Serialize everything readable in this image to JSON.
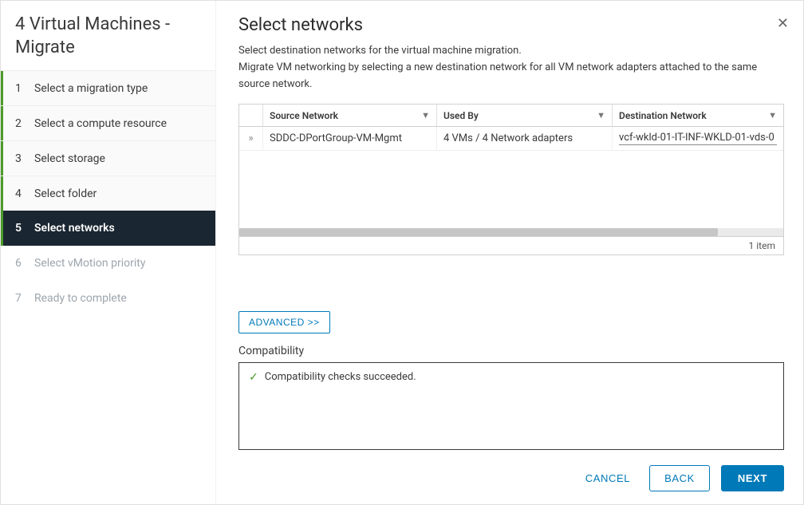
{
  "sidebar": {
    "title": "4 Virtual Machines - Migrate",
    "steps": [
      {
        "num": "1",
        "label": "Select a migration type",
        "state": "completed"
      },
      {
        "num": "2",
        "label": "Select a compute resource",
        "state": "completed"
      },
      {
        "num": "3",
        "label": "Select storage",
        "state": "completed"
      },
      {
        "num": "4",
        "label": "Select folder",
        "state": "completed"
      },
      {
        "num": "5",
        "label": "Select networks",
        "state": "current"
      },
      {
        "num": "6",
        "label": "Select vMotion priority",
        "state": "pending"
      },
      {
        "num": "7",
        "label": "Ready to complete",
        "state": "pending"
      }
    ]
  },
  "main": {
    "title": "Select networks",
    "description": "Select destination networks for the virtual machine migration.\nMigrate VM networking by selecting a new destination network for all VM network adapters attached to the same source network."
  },
  "grid": {
    "columns": {
      "source": "Source Network",
      "used_by": "Used By",
      "destination": "Destination Network"
    },
    "rows": [
      {
        "source": "SDDC-DPortGroup-VM-Mgmt",
        "used_by": "4 VMs / 4 Network adapters",
        "destination": "vcf-wkld-01-IT-INF-WKLD-01-vds-0"
      }
    ],
    "footer": "1 item"
  },
  "advanced_label": "ADVANCED >>",
  "compat": {
    "heading": "Compatibility",
    "message": "Compatibility checks succeeded."
  },
  "footer": {
    "cancel": "CANCEL",
    "back": "BACK",
    "next": "NEXT"
  }
}
